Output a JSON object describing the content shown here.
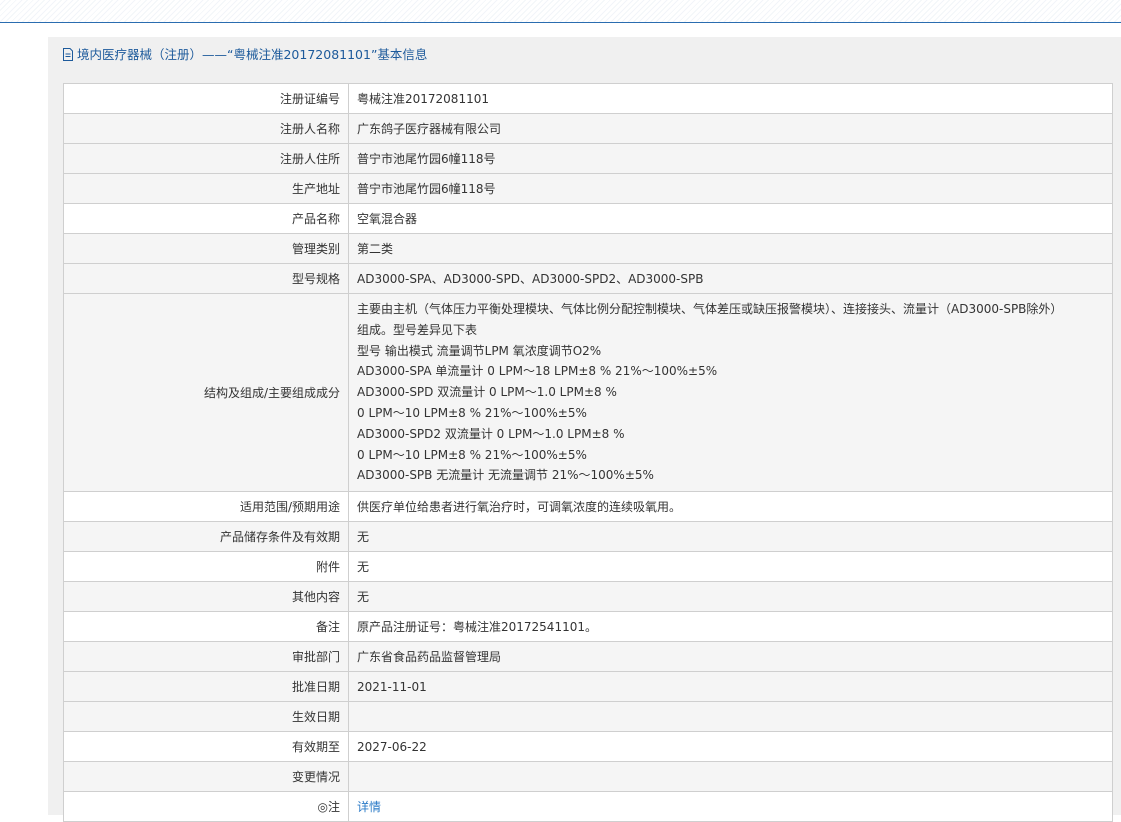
{
  "page": {
    "title": "境内医疗器械（注册）——“粤械注准20172081101”基本信息"
  },
  "rows": [
    {
      "label": "注册证编号",
      "value": "粤械注准20172081101"
    },
    {
      "label": "注册人名称",
      "value": "广东鸽子医疗器械有限公司"
    },
    {
      "label": "注册人住所",
      "value": "普宁市池尾竹园6幢118号"
    },
    {
      "label": "生产地址",
      "value": "普宁市池尾竹园6幢118号"
    },
    {
      "label": "产品名称",
      "value": "空氧混合器"
    },
    {
      "label": "管理类别",
      "value": "第二类"
    },
    {
      "label": "型号规格",
      "value": "AD3000-SPA、AD3000-SPD、AD3000-SPD2、AD3000-SPB"
    },
    {
      "label": "结构及组成/主要组成成分",
      "lines": [
        "主要由主机（气体压力平衡处理模块、气体比例分配控制模块、气体差压或缺压报警模块）、连接接头、流量计（AD3000-SPB除外）",
        "组成。型号差异见下表",
        "型号 输出模式 流量调节LPM 氧浓度调节O2%",
        "AD3000-SPA 单流量计 0 LPM～18 LPM±8 % 21%～100%±5%",
        "AD3000-SPD 双流量计 0 LPM～1.0 LPM±8 %",
        "0 LPM～10 LPM±8 % 21%～100%±5%",
        "AD3000-SPD2 双流量计 0 LPM～1.0 LPM±8 %",
        "0 LPM～10 LPM±8 % 21%～100%±5%",
        "AD3000-SPB 无流量计 无流量调节 21%～100%±5%"
      ]
    },
    {
      "label": "适用范围/预期用途",
      "value": "供医疗单位给患者进行氧治疗时，可调氧浓度的连续吸氧用。"
    },
    {
      "label": "产品储存条件及有效期",
      "value": "无"
    },
    {
      "label": "附件",
      "value": "无"
    },
    {
      "label": "其他内容",
      "value": "无"
    },
    {
      "label": "备注",
      "value": "原产品注册证号：粤械注准20172541101。"
    },
    {
      "label": "审批部门",
      "value": "广东省食品药品监督管理局"
    },
    {
      "label": "批准日期",
      "value": "2021-11-01"
    },
    {
      "label": "生效日期",
      "value": ""
    },
    {
      "label": "有效期至",
      "value": "2027-06-22"
    },
    {
      "label": "变更情况",
      "value": ""
    },
    {
      "label": "◎注",
      "value": "详情"
    }
  ]
}
